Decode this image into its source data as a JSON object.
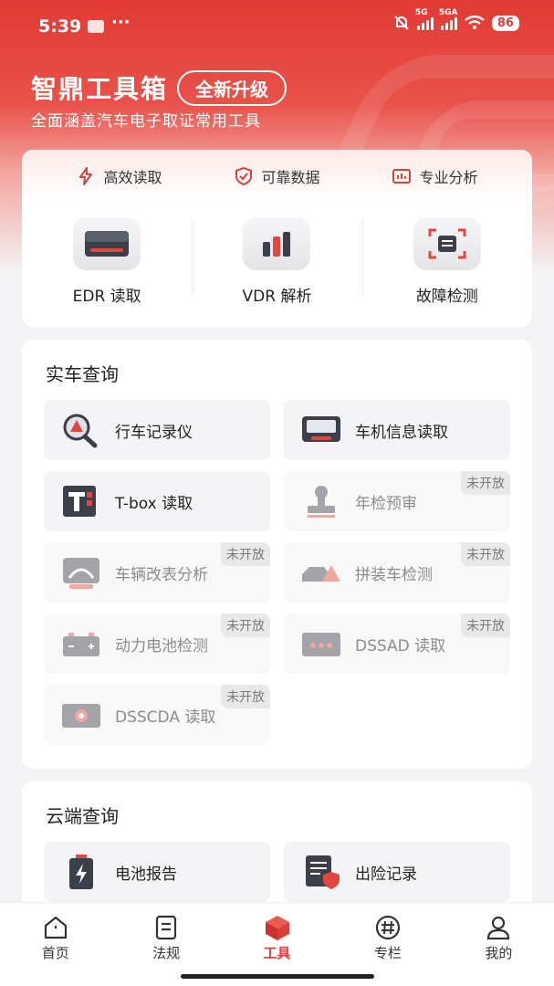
{
  "status_bar": {
    "time": "5:39",
    "dots": "···",
    "net1": "5G",
    "net2": "5GA",
    "battery": "86"
  },
  "header": {
    "title": "智鼎工具箱",
    "badge": "全新升级",
    "subtitle": "全面涵盖汽车电子取证常用工具"
  },
  "features": [
    {
      "label": "高效读取",
      "icon": "lightning-icon"
    },
    {
      "label": "可靠数据",
      "icon": "shield-check-icon"
    },
    {
      "label": "专业分析",
      "icon": "analysis-chart-icon"
    }
  ],
  "main_tools": [
    {
      "label": "EDR 读取",
      "icon": "edr-device-icon"
    },
    {
      "label": "VDR 解析",
      "icon": "bar-chart-icon"
    },
    {
      "label": "故障检测",
      "icon": "scan-frame-icon"
    }
  ],
  "real_vehicle": {
    "title": "实车查询",
    "items": [
      {
        "label": "行车记录仪",
        "status": ""
      },
      {
        "label": "车机信息读取",
        "status": ""
      },
      {
        "label": "T-box 读取",
        "status": ""
      },
      {
        "label": "年检预审",
        "status": "未开放"
      },
      {
        "label": "车辆改表分析",
        "status": "未开放"
      },
      {
        "label": "拼装车检测",
        "status": "未开放"
      },
      {
        "label": "动力电池检测",
        "status": "未开放"
      },
      {
        "label": "DSSAD 读取",
        "status": "未开放"
      },
      {
        "label": "DSSCDA 读取",
        "status": "未开放"
      }
    ]
  },
  "cloud": {
    "title": "云端查询",
    "items": [
      {
        "label": "电池报告",
        "status": ""
      },
      {
        "label": "出险记录",
        "status": ""
      }
    ]
  },
  "tabs": [
    {
      "label": "首页",
      "active": false
    },
    {
      "label": "法规",
      "active": false
    },
    {
      "label": "工具",
      "active": true
    },
    {
      "label": "专栏",
      "active": false
    },
    {
      "label": "我的",
      "active": false
    }
  ],
  "colors": {
    "brand": "#d8403a",
    "header_red": "#e23a35",
    "muted": "#8c8c8c"
  }
}
